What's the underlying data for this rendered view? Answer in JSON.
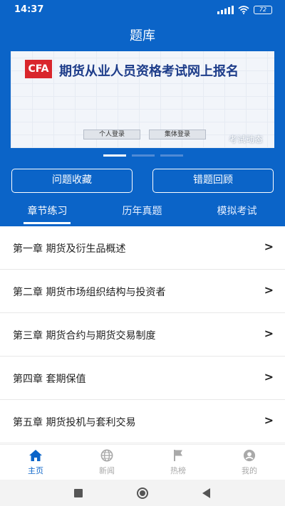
{
  "status_bar": {
    "time": "14:37",
    "battery": "72"
  },
  "header": {
    "title": "题库"
  },
  "banner": {
    "logo_text": "CFA",
    "headline": "期货从业人员资格考试网上报名",
    "button_personal": "个人登录",
    "button_group": "集体登录",
    "caption": "考试动态"
  },
  "quick_actions": {
    "favorites": "问题收藏",
    "mistakes": "错题回顾"
  },
  "tabs": [
    {
      "label": "章节练习",
      "active": true
    },
    {
      "label": "历年真题",
      "active": false
    },
    {
      "label": "模拟考试",
      "active": false
    }
  ],
  "chapters": [
    "第一章 期货及衍生品概述",
    "第二章 期货市场组织结构与投资者",
    "第三章 期货合约与期货交易制度",
    "第四章 套期保值",
    "第五章 期货投机与套利交易"
  ],
  "bottom_nav": [
    {
      "label": "主页",
      "icon": "home-icon",
      "active": true
    },
    {
      "label": "新闻",
      "icon": "globe-icon",
      "active": false
    },
    {
      "label": "热榜",
      "icon": "flag-icon",
      "active": false
    },
    {
      "label": "我的",
      "icon": "profile-icon",
      "active": false
    }
  ],
  "colors": {
    "primary": "#0b64c8",
    "inactive": "#a9a9a9"
  }
}
